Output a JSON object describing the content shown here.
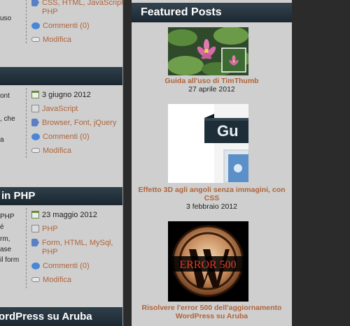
{
  "posts": [
    {
      "fragments": [
        "uso"
      ],
      "tags_line": "CSS, HTML, JavaScript,",
      "tags_line2": "PHP",
      "comments": "Commenti (0)",
      "edit": "Modifica"
    },
    {
      "title": "",
      "fragments": [
        "ont",
        "",
        ", che",
        "",
        "a"
      ],
      "date": "3 giugno 2012",
      "category": "JavaScript",
      "tags_line": "Browser, Font, jQuery",
      "comments": "Commenti (0)",
      "edit": "Modifica"
    },
    {
      "title": "in PHP",
      "fragments": [
        "PHP",
        "é",
        "rm,",
        "ase",
        "il form"
      ],
      "date": "23 maggio 2012",
      "category": "PHP",
      "tags_line": "Form, HTML, MySql,",
      "tags_line2": "PHP",
      "comments": "Commenti (0)",
      "edit": "Modifica"
    },
    {
      "title": "ordPress su Aruba"
    }
  ],
  "sidebar": {
    "widget_title": "Featured Posts",
    "featured": [
      {
        "title": "Guida all'uso di TimThumb",
        "date": "27 aprile 2012"
      },
      {
        "thumb_text": "Gu",
        "title": "Effetto 3D agli angoli senza immagini, con CSS",
        "date": "3 febbraio 2012"
      },
      {
        "thumb_text": "ERROR 500",
        "title": "Risolvere l'error 500 dell'aggiornamento WordPress su Aruba"
      }
    ]
  }
}
